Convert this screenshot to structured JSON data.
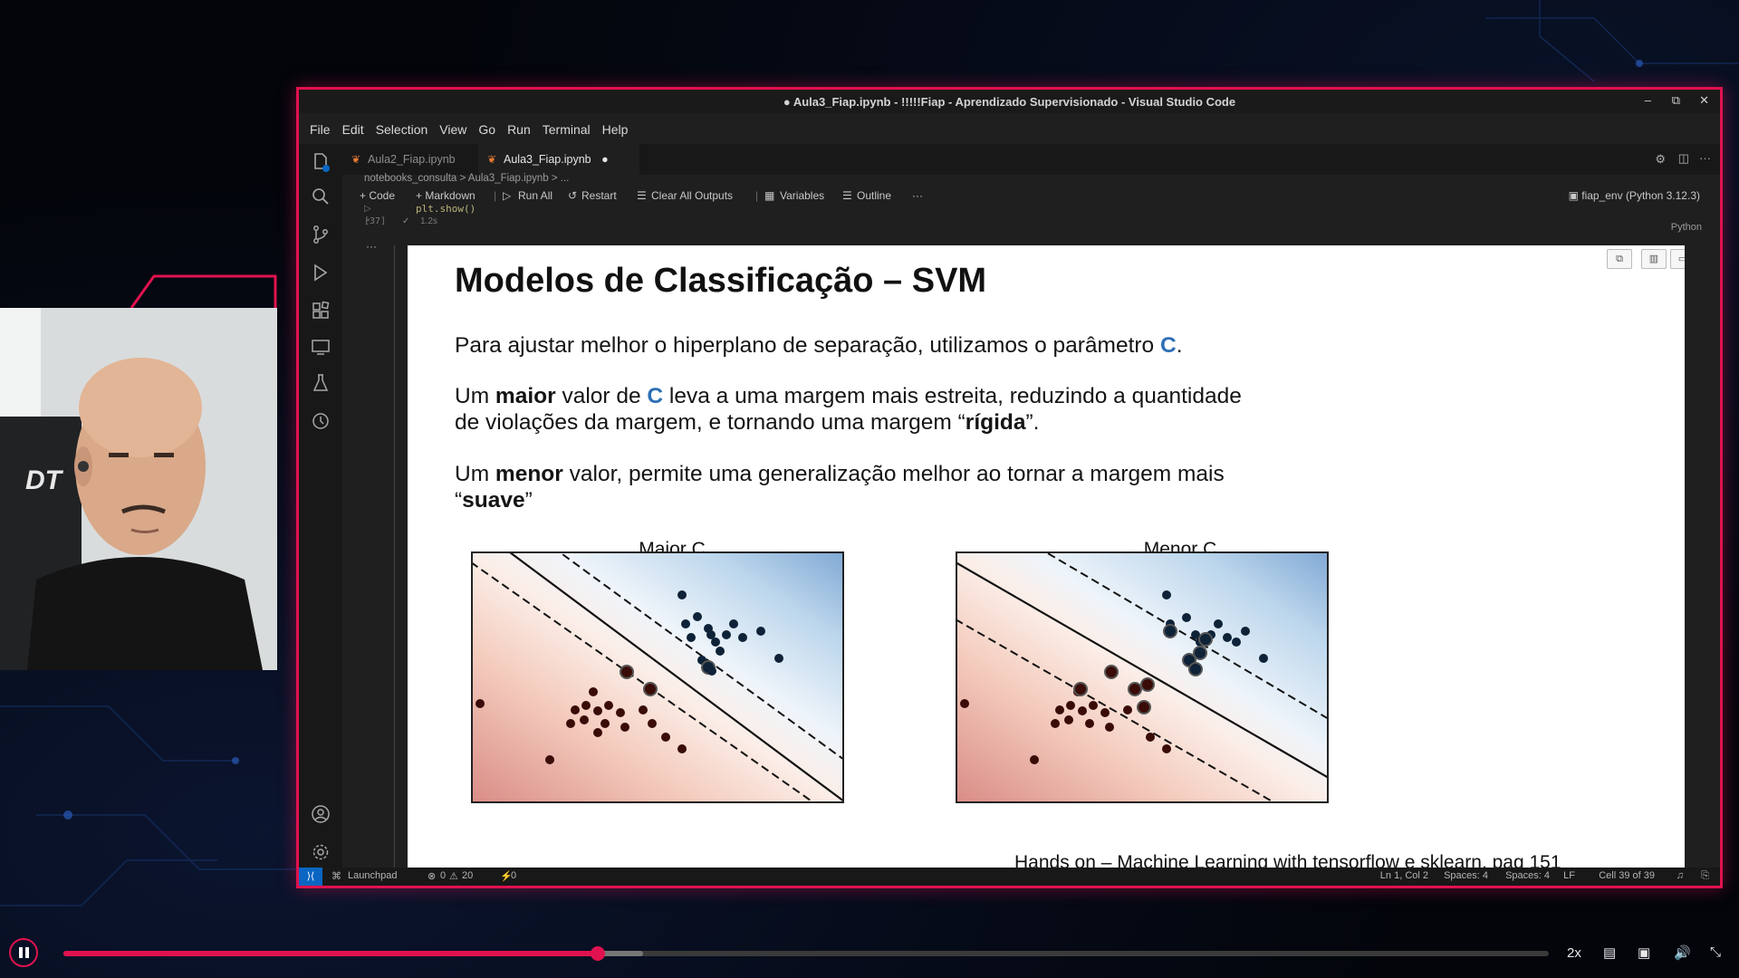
{
  "window": {
    "title": "● Aula3_Fiap.ipynb - !!!!!Fiap - Aprendizado Supervisionado - Visual Studio Code"
  },
  "menu": [
    "File",
    "Edit",
    "Selection",
    "View",
    "Go",
    "Run",
    "Terminal",
    "Help"
  ],
  "tabs": [
    {
      "label": "Aula2_Fiap.ipynb",
      "active": false
    },
    {
      "label": "Aula3_Fiap.ipynb",
      "active": true,
      "modified": "●"
    }
  ],
  "breadcrumb": "notebooks_consulta > Aula3_Fiap.ipynb > ...",
  "toolbar": {
    "code": "+ Code",
    "markdown": "+ Markdown",
    "run_all": "Run All",
    "restart": "Restart",
    "clear": "Clear All Outputs",
    "variables": "Variables",
    "outline": "Outline",
    "more": "···",
    "kernel": "fiap_env (Python 3.12.3)"
  },
  "cell": {
    "code_line": "plt.show()",
    "exec_count": "[37]",
    "duration": "1.2s",
    "language": "Python",
    "more": "···"
  },
  "slide": {
    "title": "Modelos de Classificação – SVM",
    "p1_a": "Para ajustar melhor o hiperplano de separação, utilizamos o parâmetro ",
    "p1_c": "C",
    "p1_b": ".",
    "p2_a": "Um ",
    "p2_bold": "maior",
    "p2_b": " valor de ",
    "p2_c": "C",
    "p2_c2": " leva a uma margem mais estreita, reduzindo  a quantidade",
    "p2_line2a": "de violações da margem, e tornando uma margem “",
    "p2_bold2": "rígida",
    "p2_line2b": "”.",
    "p3_a": "Um ",
    "p3_bold": "menor",
    "p3_b": " valor, permite uma generalização melhor ao tornar a margem mais",
    "p3_line2a": "“",
    "p3_bold2": "suave",
    "p3_line2b": "”",
    "chart_left_title": "Maior C",
    "chart_right_title": "Menor C",
    "footer": "Hands on – Machine Learning with tensorflow e sklearn, pag 151"
  },
  "statusbar": {
    "launchpad": "Launchpad",
    "errors": "0",
    "warnings": "20",
    "ports": "0",
    "position": "Ln 1, Col 2",
    "spaces1": "Spaces: 4",
    "spaces2": "Spaces: 4",
    "eol": "LF",
    "cell": "Cell 39 of 39"
  },
  "player": {
    "speed": "2x",
    "progress": 0.36,
    "buffered": 0.39
  },
  "colors": {
    "accent": "#e0124f",
    "vscode_bg": "#1f1f1f",
    "slide_blue": "#2d6fb5"
  }
}
